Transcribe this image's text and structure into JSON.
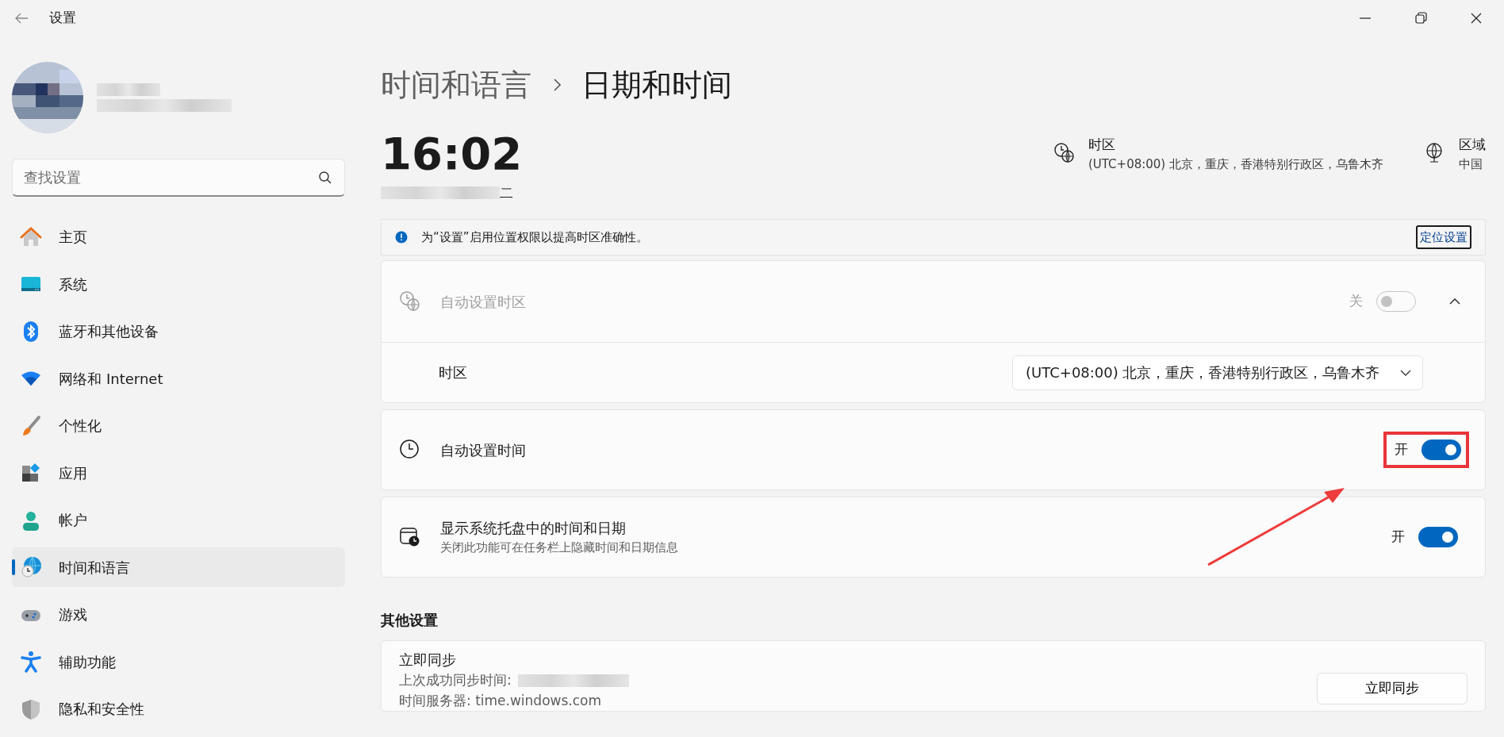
{
  "window": {
    "title": "设置"
  },
  "search": {
    "placeholder": "查找设置"
  },
  "sidebar": {
    "items": [
      {
        "label": "主页",
        "selected": false
      },
      {
        "label": "系统",
        "selected": false
      },
      {
        "label": "蓝牙和其他设备",
        "selected": false
      },
      {
        "label": "网络和 Internet",
        "selected": false
      },
      {
        "label": "个性化",
        "selected": false
      },
      {
        "label": "应用",
        "selected": false
      },
      {
        "label": "帐户",
        "selected": false
      },
      {
        "label": "时间和语言",
        "selected": true
      },
      {
        "label": "游戏",
        "selected": false
      },
      {
        "label": "辅助功能",
        "selected": false
      },
      {
        "label": "隐私和安全性",
        "selected": false
      }
    ]
  },
  "breadcrumb": [
    "时间和语言",
    "日期和时间"
  ],
  "clock": {
    "time": "16:02",
    "date_tail": "二"
  },
  "summary": [
    {
      "kind": "timezone",
      "label": "时区",
      "value": "(UTC+08:00) 北京，重庆，香港特别行政区，乌鲁木齐"
    },
    {
      "kind": "region",
      "label": "区域",
      "value": "中国"
    }
  ],
  "notice": {
    "text": "为“设置”启用位置权限以提高时区准确性。",
    "link": "定位设置"
  },
  "settings": [
    {
      "kind": "expander",
      "title": "自动设置时区",
      "disabled": true,
      "on": false,
      "state_label": "关",
      "expanded": true,
      "highlighted": false,
      "children": [
        {
          "kind": "dropdown",
          "label": "时区",
          "value": "(UTC+08:00) 北京，重庆，香港特别行政区，乌鲁木齐"
        }
      ]
    },
    {
      "kind": "toggle",
      "title": "自动设置时间",
      "disabled": false,
      "on": true,
      "state_label": "开",
      "highlighted": true
    },
    {
      "kind": "toggle",
      "title": "显示系统托盘中的时间和日期",
      "description": "关闭此功能可在任务栏上隐藏时间和日期信息",
      "disabled": false,
      "on": true,
      "state_label": "开",
      "highlighted": false
    }
  ],
  "other_settings": {
    "heading": "其他设置",
    "sync": {
      "title": "立即同步",
      "last_sync_label": "上次成功同步时间:",
      "server": "时间服务器: time.windows.com",
      "button": "立即同步"
    }
  }
}
